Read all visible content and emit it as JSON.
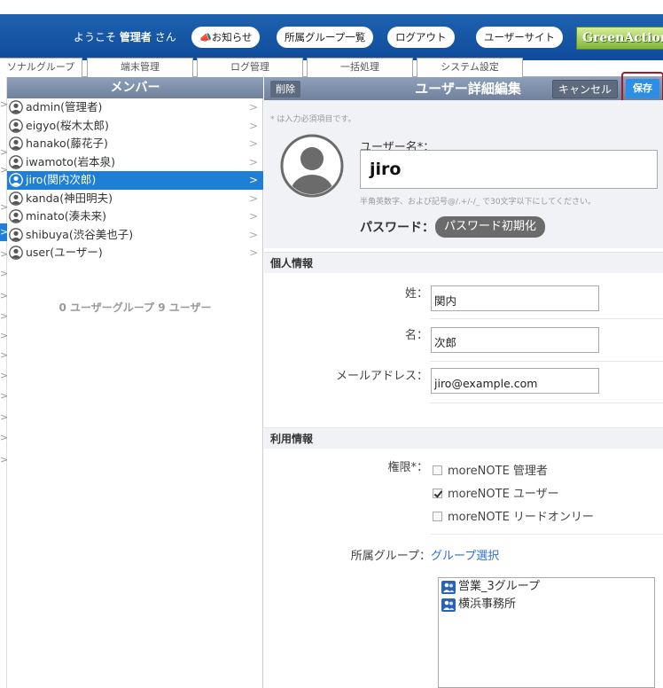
{
  "header": {
    "welcome_prefix": "ようこそ",
    "user_name": "管理者",
    "welcome_suffix": "さん",
    "buttons": {
      "notice": "お知らせ",
      "group_list": "所属グループ一覧",
      "logout": "ログアウト",
      "user_site": "ユーザーサイト"
    },
    "logo_text": "GreenAction"
  },
  "tabs": [
    "ソナルグループ",
    "端末管理",
    "ログ管理",
    "一括処理",
    "システム設定"
  ],
  "members_panel": {
    "title": "メンバー",
    "members": [
      {
        "label": "admin(管理者)",
        "selected": false
      },
      {
        "label": "eigyo(桜木太郎)",
        "selected": false
      },
      {
        "label": "hanako(藤花子)",
        "selected": false
      },
      {
        "label": "iwamoto(岩本泉)",
        "selected": false
      },
      {
        "label": "jiro(関内次郎)",
        "selected": true
      },
      {
        "label": "kanda(神田明夫)",
        "selected": false
      },
      {
        "label": "minato(湊未来)",
        "selected": false
      },
      {
        "label": "shibuya(渋谷美也子)",
        "selected": false
      },
      {
        "label": "user(ユーザー)",
        "selected": false
      }
    ],
    "summary": "0 ユーザーグループ  9 ユーザー"
  },
  "detail": {
    "delete_label": "削除",
    "title": "ユーザー詳細編集",
    "cancel_label": "キャンセル",
    "save_label": "保存",
    "required_note": "* は入力必須項目です。",
    "username_label": "ユーザー名*：",
    "username_value": "jiro",
    "username_hint": "半角英数字、および記号@/.+/-/_ で30文字以下にしてください。",
    "password_label": "パスワード：",
    "password_reset": "パスワード初期化",
    "personal_section": "個人情報",
    "last_name_label": "姓：",
    "last_name_value": "関内",
    "first_name_label": "名：",
    "first_name_value": "次郎",
    "email_label": "メールアドレス：",
    "email_value": "jiro@example.com",
    "usage_section": "利用情報",
    "permission_label": "権限*：",
    "permissions": [
      {
        "label": "moreNOTE 管理者",
        "checked": false
      },
      {
        "label": "moreNOTE ユーザー",
        "checked": true
      },
      {
        "label": "moreNOTE リードオンリー",
        "checked": false
      }
    ],
    "group_label": "所属グループ：",
    "group_select": "グループ選択",
    "groups": [
      "営業_3グループ",
      "横浜事務所"
    ]
  }
}
